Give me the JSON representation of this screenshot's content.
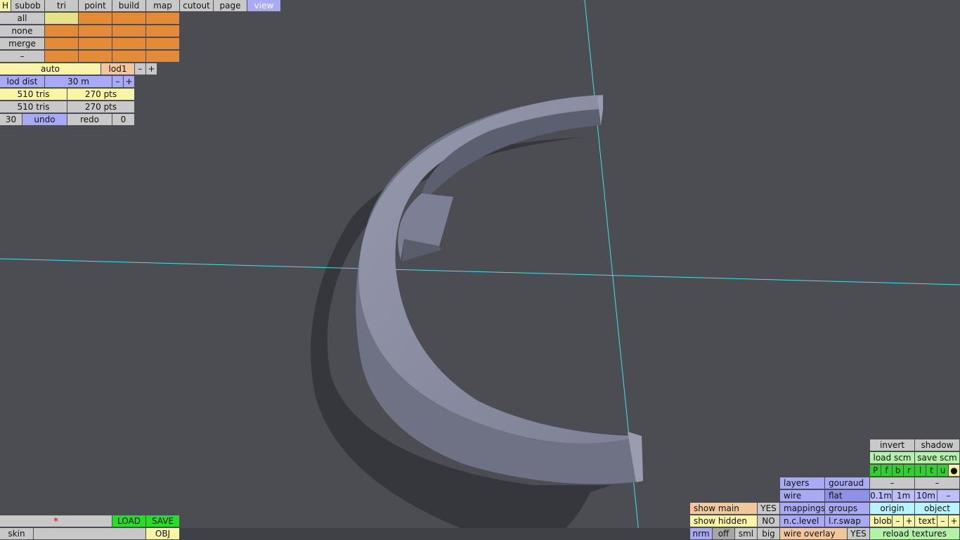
{
  "menu": {
    "h": "H",
    "tabs": [
      "subob",
      "tri",
      "point",
      "build",
      "map",
      "cutout",
      "page",
      "view"
    ],
    "active_tab": "view"
  },
  "select": {
    "all": "all",
    "none": "none",
    "merge": "merge",
    "minus": "–"
  },
  "lod": {
    "auto": "auto",
    "name": "lod1",
    "minus": "–",
    "plus": "+",
    "dist_label": "lod dist",
    "dist_value": "30 m"
  },
  "stats": {
    "tris1": "510 tris",
    "pts1": "270 pts",
    "tris2": "510 tris",
    "pts2": "270 pts"
  },
  "history": {
    "count": "30",
    "undo": "undo",
    "redo": "redo",
    "redo_count": "0"
  },
  "file": {
    "asterisk": "*",
    "load": "LOAD",
    "save": "SAVE",
    "skin": "skin",
    "obj": "OBJ"
  },
  "view_panel": {
    "invert": "invert",
    "shadow": "shadow",
    "load_scm": "load scm",
    "save_scm": "save scm",
    "dirs": [
      "P",
      "f",
      "b",
      "r",
      "l",
      "t",
      "u",
      "●"
    ],
    "dash": "–",
    "layers": "layers",
    "gouraud": "gouraud",
    "wire": "wire",
    "flat": "flat",
    "step1": "0.1m",
    "step2": "1m",
    "step3": "10m",
    "show_main": "show main",
    "show_main_val": "YES",
    "mappings": "mappings",
    "groups": "groups",
    "origin": "origin",
    "object": "object",
    "show_hidden": "show hidden",
    "show_hidden_val": "NO",
    "nc_level": "n.c.level",
    "lr_swap": "l.r.swap",
    "blob": "blob",
    "text": "text",
    "minus": "–",
    "plus": "+",
    "nrm": "nrm",
    "off": "off",
    "sml": "sml",
    "big": "big",
    "wire_overlay": "wire overlay",
    "wire_overlay_val": "YES",
    "reload_textures": "reload textures"
  },
  "colors": {
    "background": "#4b4d53",
    "axis": "#3fe3ea",
    "mesh": "#8a8da0",
    "shadow": "#35373d"
  }
}
